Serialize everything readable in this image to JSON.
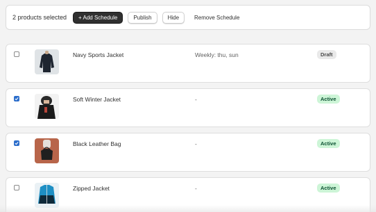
{
  "toolbar": {
    "selected_label": "2 products selected",
    "add_schedule_label": "+ Add Schedule",
    "publish_label": "Publish",
    "hide_label": "Hide",
    "remove_schedule_label": "Remove Schedule"
  },
  "products": [
    {
      "name": "Navy Sports Jacket",
      "schedule": "Weekly: thu, sun",
      "status": "Draft",
      "checked": false,
      "image": "navy-jacket-image"
    },
    {
      "name": "Soft Winter Jacket",
      "schedule": "-",
      "status": "Active",
      "checked": true,
      "image": "winter-jacket-image"
    },
    {
      "name": "Black Leather Bag",
      "schedule": "-",
      "status": "Active",
      "checked": true,
      "image": "leather-bag-image"
    },
    {
      "name": "Zipped Jacket",
      "schedule": "-",
      "status": "Active",
      "checked": false,
      "image": "zipped-jacket-image"
    }
  ],
  "colors": {
    "primary_button": "#303030",
    "checkbox_checked": "#2c6ecb",
    "active_badge_bg": "#cdf5d7",
    "active_badge_text": "#0c5132",
    "draft_badge_bg": "#e9e9e9"
  }
}
